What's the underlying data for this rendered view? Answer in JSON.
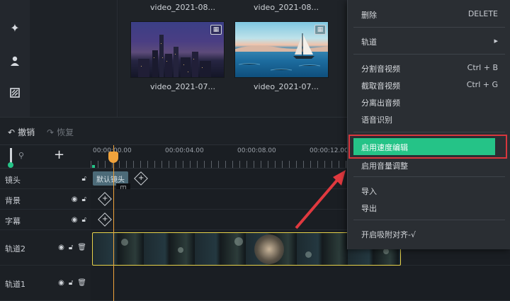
{
  "media": {
    "top_captions": [
      "video_2021-08...",
      "video_2021-08..."
    ],
    "thumbs": [
      {
        "caption": "video_2021-07..."
      },
      {
        "caption": "video_2021-07..."
      }
    ]
  },
  "toolbar": {
    "undo_label": "撤销",
    "redo_label": "恢复"
  },
  "timeline": {
    "ruler_ticks": [
      "00:00:00.00",
      "00:00:04.00",
      "00:00:08.00",
      "00:00:12.00"
    ],
    "default_shot_label": "默认镜头",
    "tracks": [
      {
        "name": "镜头"
      },
      {
        "name": "背景"
      },
      {
        "name": "字幕"
      },
      {
        "name": "轨道2"
      },
      {
        "name": "轨道1"
      }
    ]
  },
  "context_menu": {
    "items": [
      {
        "label": "删除",
        "shortcut": "DELETE"
      },
      {
        "label": "轨道",
        "shortcut": "▸"
      },
      {
        "label": "分割音视频",
        "shortcut": "Ctrl + B"
      },
      {
        "label": "截取音视频",
        "shortcut": "Ctrl + G"
      },
      {
        "label": "分离出音频",
        "shortcut": ""
      },
      {
        "label": "语音识别",
        "shortcut": ""
      },
      {
        "label": "启用速度编辑",
        "shortcut": ""
      },
      {
        "label": "启用音量调整",
        "shortcut": ""
      },
      {
        "label": "导入",
        "shortcut": ""
      },
      {
        "label": "导出",
        "shortcut": ""
      },
      {
        "label": "开启吸附对齐-√",
        "shortcut": ""
      }
    ]
  },
  "colors": {
    "accent": "#25c387",
    "highlight_border": "#d7363d",
    "playhead": "#f0a33c",
    "clip_border": "#e8d34a"
  }
}
